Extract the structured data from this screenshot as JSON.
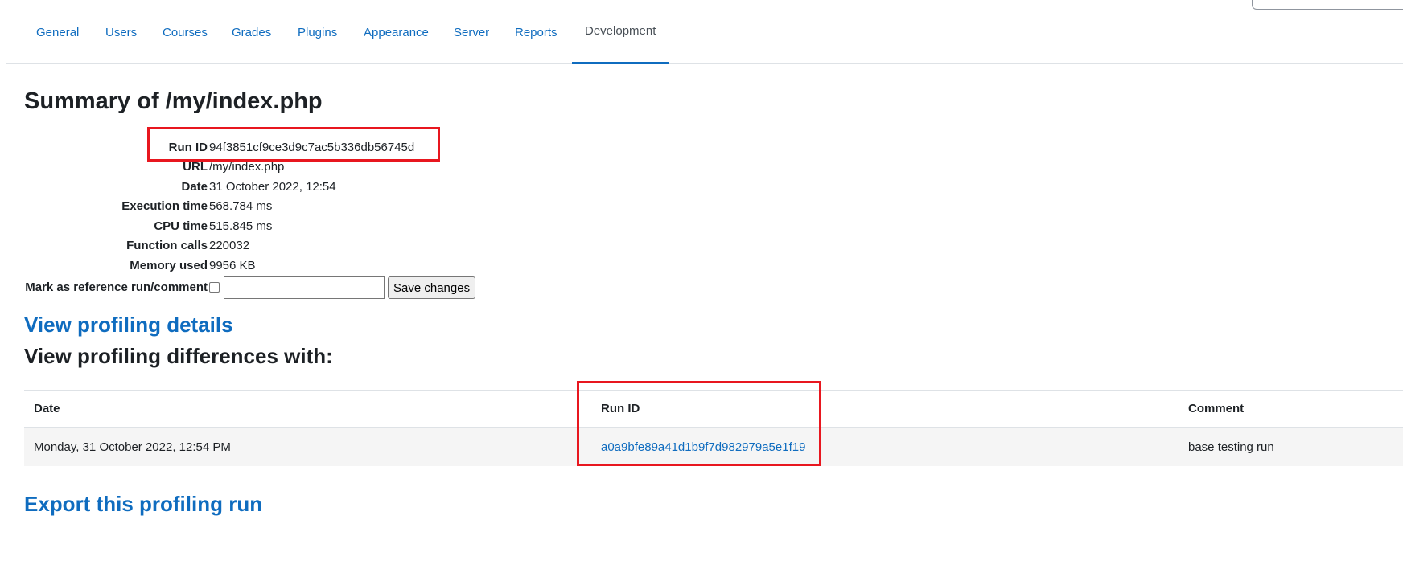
{
  "tabs": [
    {
      "label": "General"
    },
    {
      "label": "Users"
    },
    {
      "label": "Courses"
    },
    {
      "label": "Grades"
    },
    {
      "label": "Plugins"
    },
    {
      "label": "Appearance"
    },
    {
      "label": "Server"
    },
    {
      "label": "Reports"
    },
    {
      "label": "Development",
      "active": true
    }
  ],
  "summary": {
    "title": "Summary of /my/index.php",
    "properties": [
      {
        "label": "Run ID",
        "value": "94f3851cf9ce3d9c7ac5b336db56745d"
      },
      {
        "label": "URL",
        "value": "/my/index.php"
      },
      {
        "label": "Date",
        "value": "31 October 2022, 12:54"
      },
      {
        "label": "Execution time",
        "value": "568.784 ms"
      },
      {
        "label": "CPU time",
        "value": "515.845 ms"
      },
      {
        "label": "Function calls",
        "value": "220032"
      },
      {
        "label": "Memory used",
        "value": "9956 KB"
      }
    ],
    "reference_label": "Mark as reference run/comment",
    "reference_checked": false,
    "comment_value": "",
    "save_label": "Save changes"
  },
  "view_details_label": "View profiling details",
  "diff_heading": "View profiling differences with:",
  "diff_table": {
    "headers": [
      "Date",
      "Run ID",
      "Comment"
    ],
    "rows": [
      {
        "date": "Monday, 31 October 2022, 12:54 PM",
        "run_id": "a0a9bfe89a41d1b9f7d982979a5e1f19",
        "comment": "base testing run"
      }
    ]
  },
  "export_label": "Export this profiling run",
  "colors": {
    "link": "#0f6cbf",
    "text": "#1d2125",
    "highlight": "#e8171f",
    "row_bg": "#f5f5f5"
  }
}
